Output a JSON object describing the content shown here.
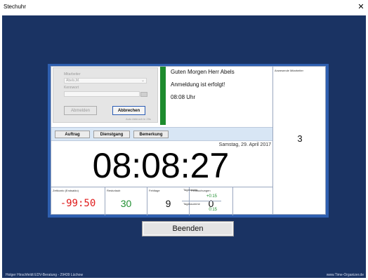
{
  "window": {
    "title": "Stechuhr",
    "close_glyph": "✕"
  },
  "login": {
    "employee_label": "Mitarbeiter",
    "employee_value": "Abels,M.",
    "password_label": "Kennwort",
    "password_value": "",
    "logout_label": "Abmelden",
    "cancel_label": "Abbrechen",
    "auto_cancel_text": "Auto Abbruch in 29s"
  },
  "messages": {
    "greeting": "Guten Morgen Herr Abels",
    "status": "Anmeldung ist erfolgt!",
    "time": "08:08 Uhr"
  },
  "present": {
    "title": "Anwesende Mitarbeiter",
    "count": "3"
  },
  "toolbar": {
    "auftrag": "Auftrag",
    "dienstgang": "Dienstgang",
    "bemerkung": "Bemerkung"
  },
  "date": "Samstag, 29. April 2017",
  "clock": "08:08:27",
  "stats": {
    "zeitkonto": {
      "label": "Zeitkonto (Endsaldo)",
      "value": "-99:50",
      "color": "#e01b1b"
    },
    "resturlaub": {
      "label": "Resturlaub",
      "value": "30",
      "color": "#1e8e2f"
    },
    "fehltage": {
      "label": "Fehltage",
      "value": "9",
      "color": "#111111"
    },
    "fehlbuchungen": {
      "label": "Fehlbuchungen",
      "value": "0",
      "color": "#111111"
    },
    "tagessaldo": {
      "label": "Tagessaldo",
      "value": "+0:15"
    },
    "tagessumme": {
      "label": "Tagessumme",
      "value": "0:15"
    }
  },
  "exit_button": "Beenden",
  "footer": {
    "left": "Holger Hirschfeldt EDV-Beratung - 29439 Lüchow",
    "right": "www.Time-Organizer.de"
  },
  "colors": {
    "background": "#1a3363",
    "frame": "#2e5fb0",
    "status_green": "#1d8b2d",
    "negative": "#e01b1b",
    "positive": "#1e8e2f"
  }
}
